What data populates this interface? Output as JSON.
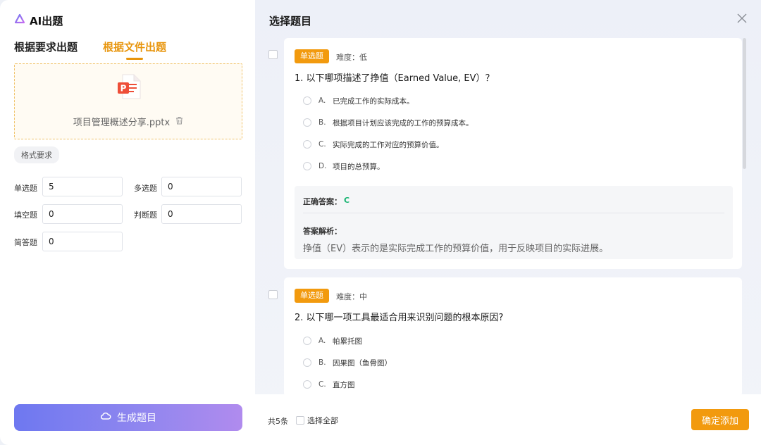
{
  "app": {
    "title": "AI出题"
  },
  "left": {
    "tabs": [
      {
        "label": "根据要求出题",
        "active": false
      },
      {
        "label": "根据文件出题",
        "active": true
      }
    ],
    "upload": {
      "file_name": "项目管理概述分享.pptx"
    },
    "format_tag": "格式要求",
    "fields": [
      {
        "label": "单选题",
        "value": "5"
      },
      {
        "label": "多选题",
        "value": "0"
      },
      {
        "label": "填空题",
        "value": "0"
      },
      {
        "label": "判断题",
        "value": "0"
      },
      {
        "label": "简答题",
        "value": "0"
      }
    ],
    "generate_label": "生成题目"
  },
  "right": {
    "title": "选择题目",
    "questions": [
      {
        "type": "单选题",
        "difficulty": "难度：低",
        "text": "1. 以下哪项描述了挣值（Earned Value, EV）？",
        "options": [
          {
            "letter": "A.",
            "text": "已完成工作的实际成本。"
          },
          {
            "letter": "B.",
            "text": "根据项目计划应该完成的工作的预算成本。"
          },
          {
            "letter": "C.",
            "text": "实际完成的工作对应的预算价值。"
          },
          {
            "letter": "D.",
            "text": "项目的总预算。"
          }
        ],
        "answer_label": "正确答案：",
        "answer": "C",
        "explanation_label": "答案解析：",
        "explanation": "挣值（EV）表示的是实际完成工作的预算价值，用于反映项目的实际进展。"
      },
      {
        "type": "单选题",
        "difficulty": "难度：中",
        "text": "2. 以下哪一项工具最适合用来识别问题的根本原因?",
        "options": [
          {
            "letter": "A.",
            "text": "帕累托图"
          },
          {
            "letter": "B.",
            "text": "因果图（鱼骨图）"
          },
          {
            "letter": "C.",
            "text": "直方图"
          }
        ]
      }
    ],
    "footer": {
      "count": "共5条",
      "select_all": "选择全部",
      "confirm_label": "确定添加"
    }
  },
  "colors": {
    "accent": "#f29a0e",
    "tab_active": "#e8950c",
    "answer": "#18b472"
  }
}
